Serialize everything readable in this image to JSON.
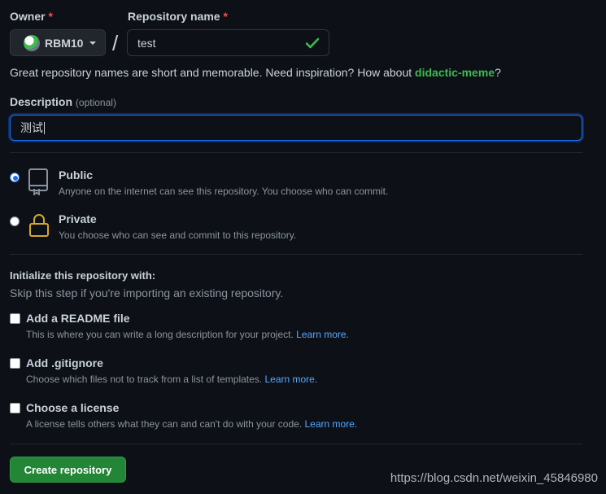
{
  "owner": {
    "label": "Owner",
    "required_mark": "*",
    "selected": "RBM10"
  },
  "repo_name": {
    "label": "Repository name",
    "required_mark": "*",
    "value": "test",
    "separator": "/"
  },
  "hint": {
    "text": "Great repository names are short and memorable. Need inspiration? How about ",
    "suggestion": "didactic-meme",
    "end": "?"
  },
  "description": {
    "label": "Description",
    "optional": "(optional)",
    "value": "测试"
  },
  "visibility": {
    "public": {
      "title": "Public",
      "desc": "Anyone on the internet can see this repository. You choose who can commit.",
      "selected": true
    },
    "private": {
      "title": "Private",
      "desc": "You choose who can see and commit to this repository.",
      "selected": false
    }
  },
  "init": {
    "title": "Initialize this repository with:",
    "subtitle": "Skip this step if you're importing an existing repository.",
    "readme": {
      "title": "Add a README file",
      "desc": "This is where you can write a long description for your project.",
      "link": "Learn more."
    },
    "gitignore": {
      "title": "Add .gitignore",
      "desc": "Choose which files not to track from a list of templates.",
      "link": "Learn more."
    },
    "license": {
      "title": "Choose a license",
      "desc": "A license tells others what they can and can't do with your code.",
      "link": "Learn more."
    }
  },
  "create_button": "Create repository",
  "watermark": "https://blog.csdn.net/weixin_45846980",
  "colors": {
    "background": "#0d1117",
    "accent_green": "#238636",
    "link_blue": "#58a6ff",
    "required_red": "#f85149"
  }
}
